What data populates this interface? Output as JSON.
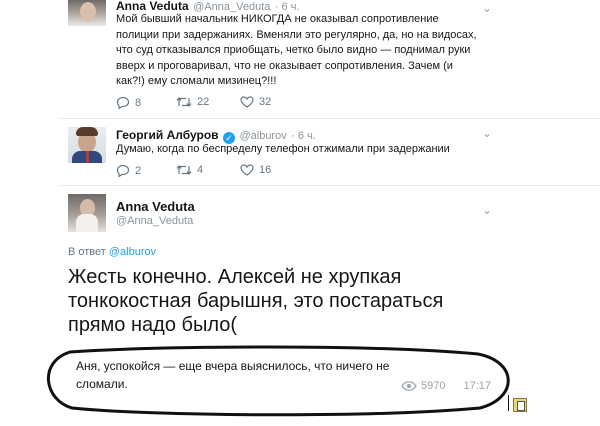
{
  "tweet1": {
    "name": "Anna Veduta",
    "handle": "@Anna_Veduta",
    "time": "· 6 ч.",
    "text": "Мой бывший начальник НИКОГДА не оказывал сопротивление полиции при задержаниях. Вменяли это регулярно, да, но на видосах, что суд отказывался приобщать, четко было видно — поднимал руки вверх и проговаривал, что не оказывает сопротивления. Зачем (и как?!) ему сломали мизинец?!!!",
    "replies": "8",
    "retweets": "22",
    "likes": "32"
  },
  "tweet2": {
    "name": "Георгий Албуров",
    "handle": "@alburov",
    "time": "· 6 ч.",
    "text": "Думаю, когда по беспределу телефон отжимали при задержании",
    "replies": "2",
    "retweets": "4",
    "likes": "16"
  },
  "tweet3": {
    "name": "Anna Veduta",
    "handle": "@Anna_Veduta",
    "reply_prefix": "В ответ",
    "reply_to": "@alburov",
    "text": "Жесть конечно. Алексей не хрупкая тонкокостная барышня, это постараться прямо надо было("
  },
  "comment": {
    "text": "Аня, успокойся — еще вчера выяснилось, что ничего не сломали.",
    "views": "5970",
    "time": "17:17"
  },
  "colors": {
    "link": "#1da1f2",
    "verified": "#1da1f2",
    "muted": "#657786"
  }
}
